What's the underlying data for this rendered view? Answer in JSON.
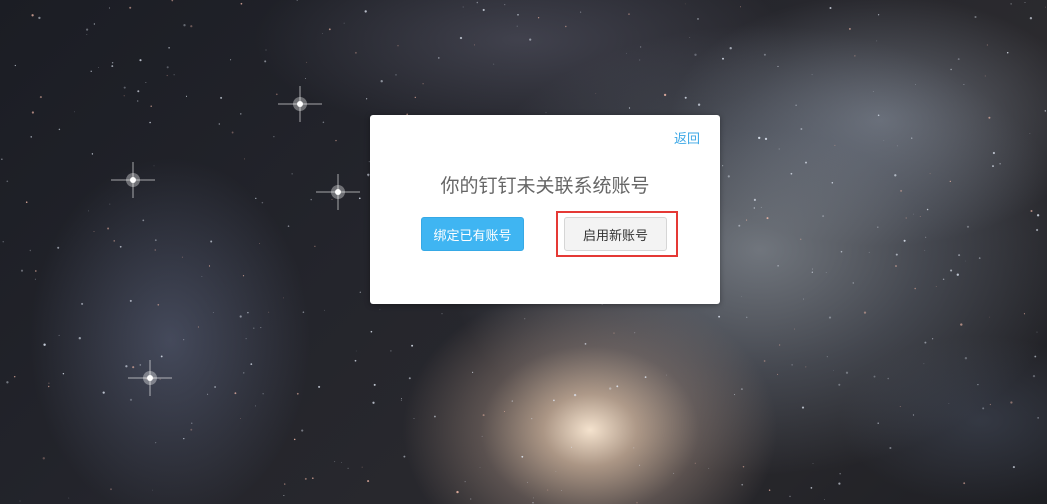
{
  "background": {
    "description_icon": "galaxy-image"
  },
  "dialog": {
    "back_label": "返回",
    "title": "你的钉钉未关联系统账号",
    "bind_existing_label": "绑定已有账号",
    "create_new_label": "启用新账号"
  },
  "colors": {
    "link": "#3ba7e6",
    "primary_button": "#3fb5f2",
    "highlight": "#e53935"
  }
}
